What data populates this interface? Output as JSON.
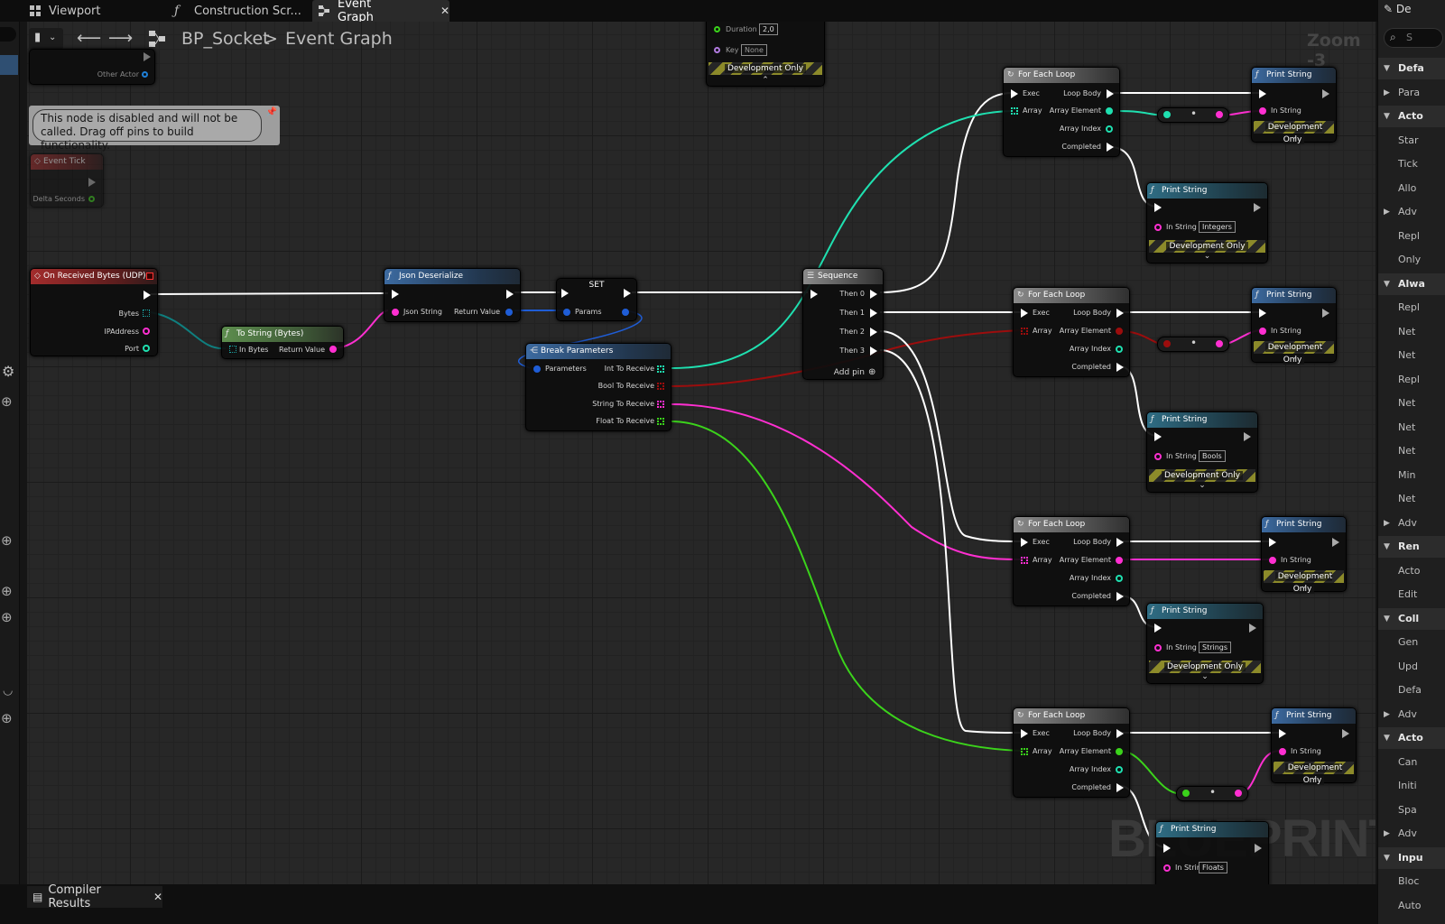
{
  "tabs": [
    {
      "label": "Viewport"
    },
    {
      "label": "Construction Scr..."
    },
    {
      "label": "Event Graph"
    }
  ],
  "toolbar": {
    "blueprint": "BP_Socket",
    "separator": ">",
    "graph": "Event Graph",
    "zoom": "Zoom -3"
  },
  "watermark": "BLUEPRINT",
  "bottom": {
    "compiler": "Compiler Results"
  },
  "comment": "This node is disabled and will not be called. Drag off pins to build functionality.",
  "top_fragment": {
    "duration_label": "Duration",
    "duration_value": "2,0",
    "key_label": "Key",
    "key_value": "None",
    "dev": "Development Only"
  },
  "frag_left": {
    "other_actor": "Other Actor"
  },
  "event_tick": {
    "title": "Event Tick",
    "delta": "Delta Seconds"
  },
  "udp": {
    "title": "On Received Bytes (UDP)",
    "bytes": "Bytes",
    "ip": "IPAddress",
    "port": "Port"
  },
  "tostring": {
    "title": "To String (Bytes)",
    "in": "In Bytes",
    "out": "Return Value"
  },
  "json": {
    "title": "Json Deserialize",
    "in": "Json String",
    "out": "Return Value"
  },
  "set": {
    "title": "SET",
    "params": "Params"
  },
  "break": {
    "title": "Break Parameters",
    "in": "Parameters",
    "o1": "Int To Receive",
    "o2": "Bool To Receive",
    "o3": "String To Receive",
    "o4": "Float To Receive"
  },
  "sequence": {
    "title": "Sequence",
    "t0": "Then 0",
    "t1": "Then 1",
    "t2": "Then 2",
    "t3": "Then 3",
    "add": "Add pin"
  },
  "loop": {
    "title": "For Each Loop",
    "exec": "Exec",
    "array": "Array",
    "body": "Loop Body",
    "element": "Array Element",
    "index": "Array Index",
    "completed": "Completed"
  },
  "print": {
    "title": "Print String",
    "in": "In String",
    "dev": "Development Only"
  },
  "print_values": {
    "integers": "Integers",
    "bools": "Bools",
    "strings": "Strings",
    "floats": "Floats"
  },
  "right_panel": {
    "title": "De",
    "search": "S",
    "rows": [
      "Defa",
      "Para",
      "Acto",
      "Star",
      "Tick",
      "Allo",
      "Adv",
      "Repl",
      "Only",
      "Alwa",
      "Repl",
      "Net",
      "Net",
      "Repl",
      "Net",
      "Net",
      "Net",
      "Min",
      "Net",
      "Adv",
      "Ren",
      "Acto",
      "Edit",
      "Coll",
      "Gen",
      "Upd",
      "Defa",
      "Adv",
      "Acto",
      "Can",
      "Initi",
      "Spa",
      "Adv",
      "Inpu",
      "Bloc",
      "Auto"
    ]
  },
  "colors": {
    "exec": "#ffffff",
    "int": "#1fe0b0",
    "bool": "#9c0d0d",
    "string": "#ff2fd1",
    "float": "#3bd31b",
    "struct": "#1f5dd6",
    "bytes": "#0f7f7f"
  }
}
